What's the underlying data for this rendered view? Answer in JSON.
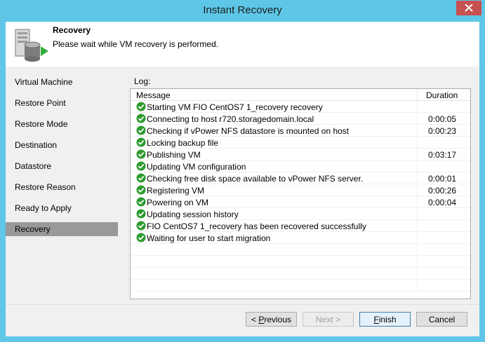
{
  "window": {
    "title": "Instant Recovery"
  },
  "header": {
    "title": "Recovery",
    "subtitle": "Please wait while VM recovery is performed."
  },
  "sidebar": {
    "items": [
      {
        "label": "Virtual Machine"
      },
      {
        "label": "Restore Point"
      },
      {
        "label": "Restore Mode"
      },
      {
        "label": "Destination"
      },
      {
        "label": "Datastore"
      },
      {
        "label": "Restore Reason"
      },
      {
        "label": "Ready to Apply"
      },
      {
        "label": "Recovery",
        "active": true
      }
    ]
  },
  "log": {
    "label": "Log:",
    "columns": {
      "message": "Message",
      "duration": "Duration"
    },
    "rows": [
      {
        "message": "Starting VM FIO CentOS7 1_recovery recovery",
        "duration": "",
        "status_icon": "success-check-icon"
      },
      {
        "message": "Connecting to host r720.storagedomain.local",
        "duration": "0:00:05",
        "status_icon": "success-check-icon"
      },
      {
        "message": "Checking if vPower NFS datastore is mounted on host",
        "duration": "0:00:23",
        "status_icon": "success-check-icon"
      },
      {
        "message": "Locking backup file",
        "duration": "",
        "status_icon": "success-check-icon"
      },
      {
        "message": "Publishing VM",
        "duration": "0:03:17",
        "status_icon": "success-check-icon"
      },
      {
        "message": "Updating VM configuration",
        "duration": "",
        "status_icon": "success-check-icon"
      },
      {
        "message": "Checking free disk space available to vPower NFS server.",
        "duration": "0:00:01",
        "status_icon": "success-check-icon"
      },
      {
        "message": "Registering VM",
        "duration": "0:00:26",
        "status_icon": "success-check-icon"
      },
      {
        "message": "Powering on VM",
        "duration": "0:00:04",
        "status_icon": "success-check-icon"
      },
      {
        "message": "Updating session history",
        "duration": "",
        "status_icon": "success-check-icon"
      },
      {
        "message": "FIO CentOS7 1_recovery has been recovered successfully",
        "duration": "",
        "status_icon": "success-check-icon"
      },
      {
        "message": "Waiting for user to start migration",
        "duration": "",
        "status_icon": "success-check-icon"
      }
    ],
    "empty_rows": 4
  },
  "buttons": {
    "previous_prefix": "< ",
    "previous_key": "P",
    "previous_rest": "revious",
    "next": "Next >",
    "finish_key": "F",
    "finish_rest": "inish",
    "cancel": "Cancel"
  },
  "colors": {
    "titlebar": "#5ec7e8",
    "close": "#c75050",
    "selected_step": "#999999",
    "success": "#2e9b2e"
  }
}
